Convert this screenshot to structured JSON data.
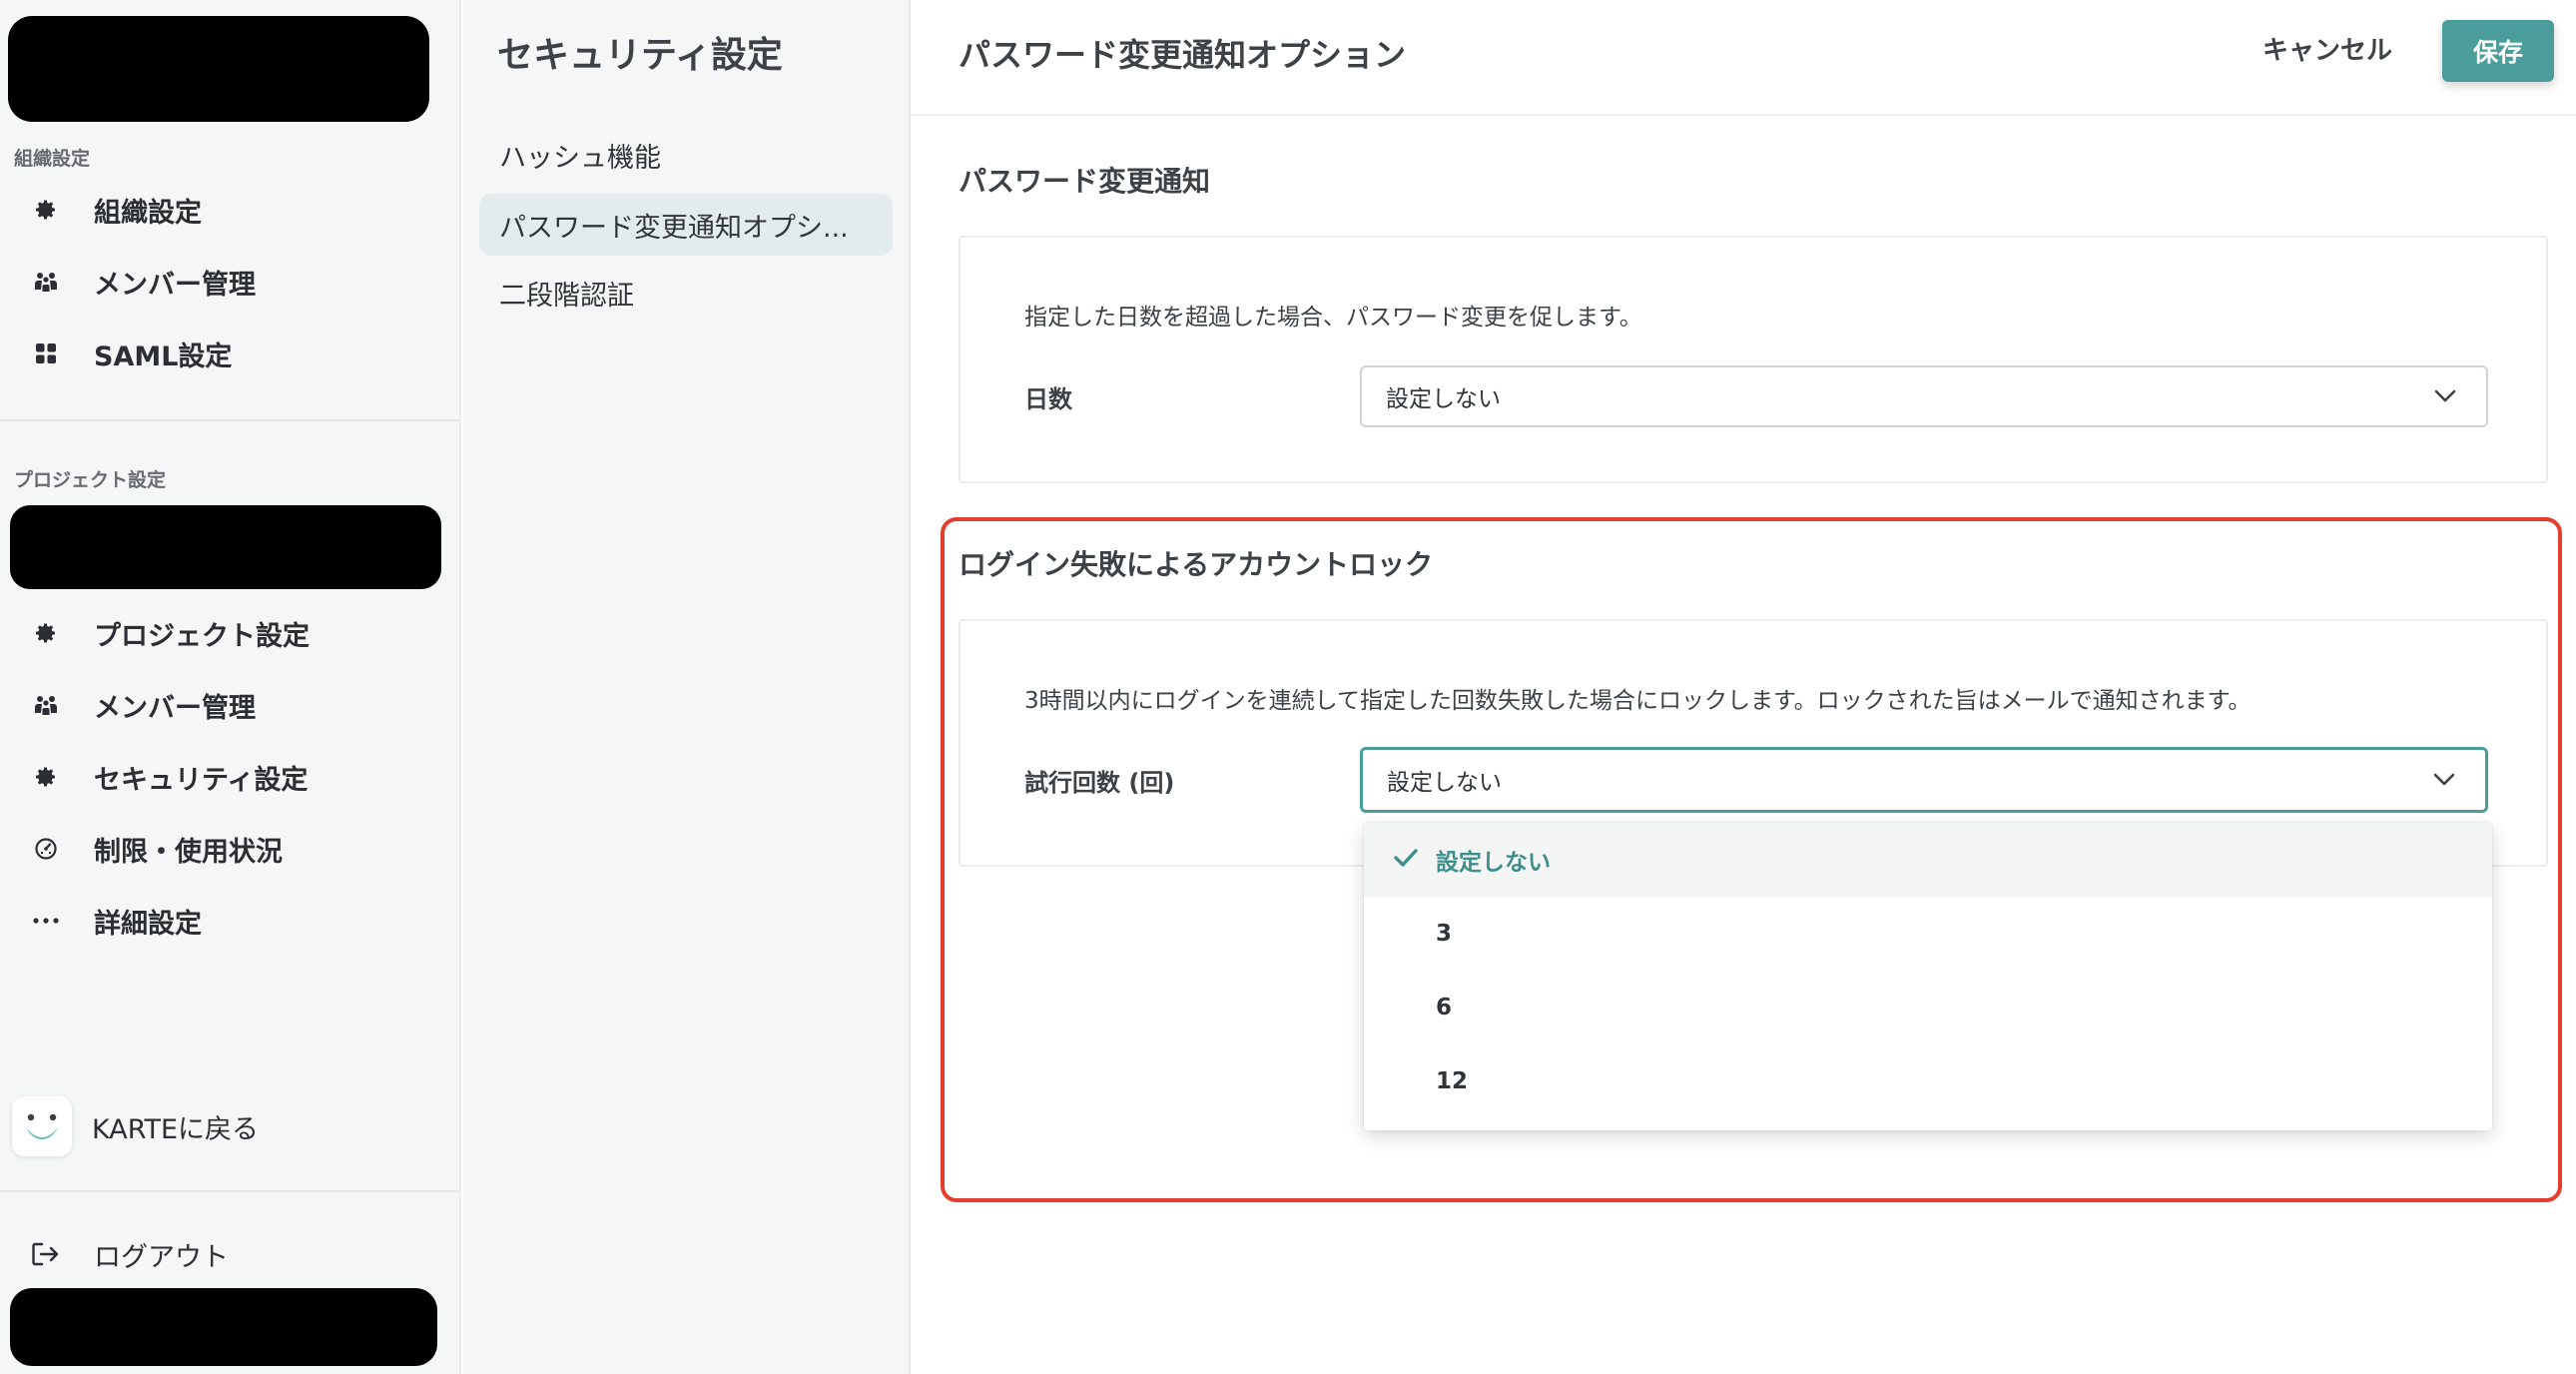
{
  "nav": {
    "org_group_title": "組織設定",
    "org_items": [
      {
        "label": "組織設定",
        "icon": "gear-icon"
      },
      {
        "label": "メンバー管理",
        "icon": "members-icon"
      },
      {
        "label": "SAML設定",
        "icon": "grid-icon"
      }
    ],
    "project_group_title": "プロジェクト設定",
    "project_items": [
      {
        "label": "プロジェクト設定",
        "icon": "gear-icon"
      },
      {
        "label": "メンバー管理",
        "icon": "members-icon"
      },
      {
        "label": "セキュリティ設定",
        "icon": "gear-icon"
      },
      {
        "label": "制限・使用状況",
        "icon": "gauge-icon"
      },
      {
        "label": "詳細設定",
        "icon": "more-icon"
      }
    ],
    "back_label": "KARTEに戻る",
    "logout_label": "ログアウト"
  },
  "subnav": {
    "title": "セキュリティ設定",
    "items": [
      {
        "label": "ハッシュ機能",
        "active": false
      },
      {
        "label": "パスワード変更通知オプシ...",
        "active": true
      },
      {
        "label": "二段階認証",
        "active": false
      }
    ]
  },
  "header": {
    "title": "パスワード変更通知オプション",
    "cancel_label": "キャンセル",
    "save_label": "保存"
  },
  "password_notice": {
    "title": "パスワード変更通知",
    "description": "指定した日数を超過した場合、パスワード変更を促します。",
    "field_label": "日数",
    "value": "設定しない"
  },
  "account_lock": {
    "title": "ログイン失敗によるアカウントロック",
    "description": "3時間以内にログインを連続して指定した回数失敗した場合にロックします。ロックされた旨はメールで通知されます。",
    "field_label": "試行回数 (回)",
    "value": "設定しない",
    "options": [
      "設定しない",
      "3",
      "6",
      "12"
    ],
    "selected_index": 0
  },
  "colors": {
    "accent": "#4a9d9a",
    "highlight_border": "#e53c2e"
  }
}
